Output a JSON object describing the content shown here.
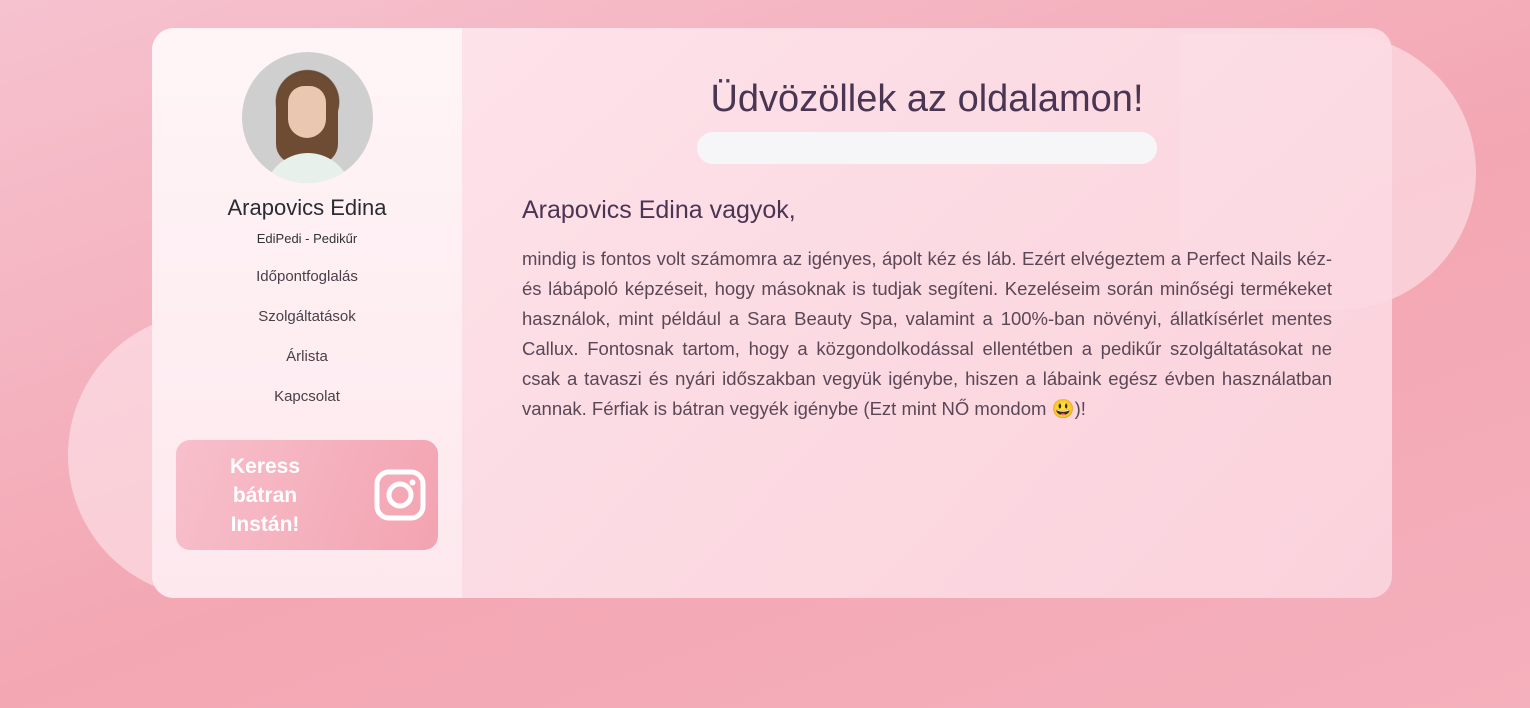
{
  "profile": {
    "name": "Arapovics Edina",
    "subtitle": "EdiPedi - Pedikűr"
  },
  "nav": {
    "items": [
      {
        "label": "Időpontfoglalás"
      },
      {
        "label": "Szolgáltatások"
      },
      {
        "label": "Árlista"
      },
      {
        "label": "Kapcsolat"
      }
    ]
  },
  "instagram": {
    "line1": "Keress",
    "line2": "bátran",
    "line3": "Instán!",
    "icon": "instagram-icon"
  },
  "main": {
    "title": "Üdvözöllek az oldalamon!",
    "intro_heading": "Arapovics Edina vagyok,",
    "intro_body": "mindig is fontos volt számomra az igényes, ápolt kéz és láb. Ezért elvégeztem a Perfect Nails kéz- és lábápoló képzéseit, hogy másoknak is tudjak segíteni. Kezeléseim során minőségi termékeket használok, mint például a Sara Beauty Spa, valamint a 100%-ban növényi, állatkísérlet mentes Callux. Fontosnak tartom, hogy a közgondolkodással ellentétben a pedikűr szolgáltatásokat ne csak a tavaszi és nyári időszakban vegyük igénybe, hiszen a lábaink egész évben használatban vannak. Férfiak is bátran vegyék igénybe (Ezt mint NŐ mondom 😃)!"
  },
  "colors": {
    "accent": "#f3a3b1",
    "heading": "#4a3552"
  }
}
